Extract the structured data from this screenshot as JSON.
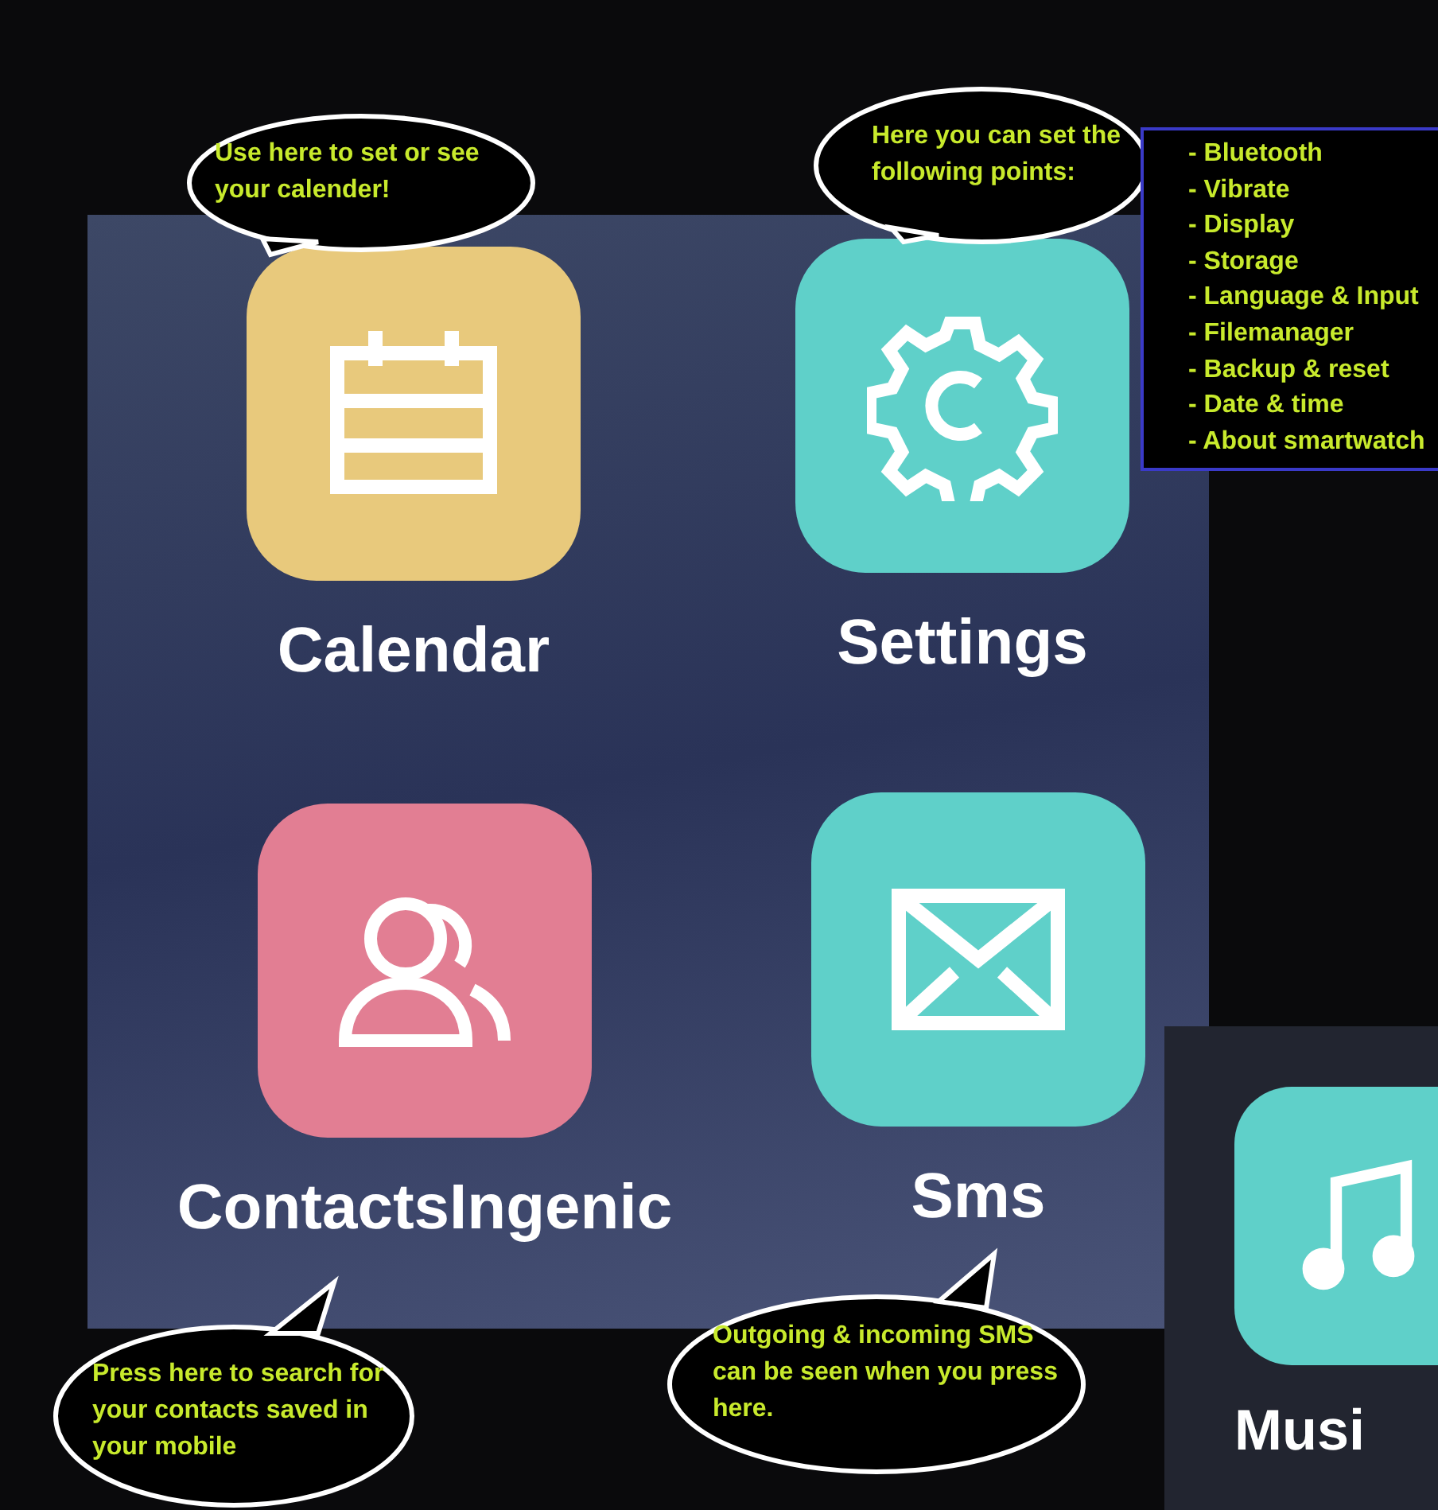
{
  "apps": [
    {
      "label": "Calendar",
      "kind": "calendar",
      "color": "#e8c97c"
    },
    {
      "label": "Settings",
      "kind": "settings",
      "color": "#5fd0c9"
    },
    {
      "label": "ContactsIngenic",
      "kind": "contacts",
      "color": "#e27e93"
    },
    {
      "label": "Sms",
      "kind": "sms",
      "color": "#5fd0c9"
    }
  ],
  "partial_app": {
    "label": "Musi",
    "kind": "music",
    "color": "#5fd0c9"
  },
  "callouts": [
    {
      "text": "Use here to set or see your calender!"
    },
    {
      "text": "Here you can set the following points:"
    },
    {
      "text": "Press here to search for your contacts saved in your mobile"
    },
    {
      "text": "Outgoing & incoming SMS can be seen when you press here."
    }
  ],
  "settings_list": [
    "- Bluetooth",
    "- Vibrate",
    "- Display",
    "- Storage",
    "- Language & Input",
    "- Filemanager",
    "- Backup & reset",
    "- Date & time",
    "- About smartwatch"
  ]
}
